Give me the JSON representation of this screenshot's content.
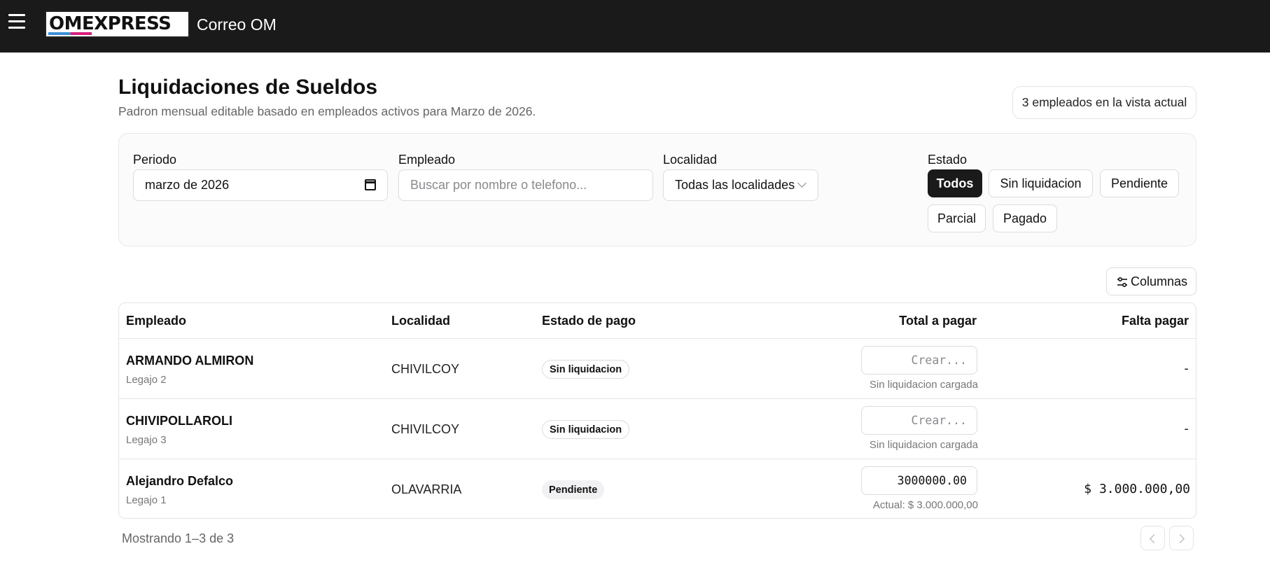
{
  "header": {
    "logo_text": "OMEXPRESS",
    "app_name": "Correo OM"
  },
  "page": {
    "title": "Liquidaciones de Sueldos",
    "subtitle": "Padron mensual editable basado en empleados activos para Marzo de 2026.",
    "count_badge": "3 empleados en la vista actual"
  },
  "filters": {
    "periodo_label": "Periodo",
    "periodo_value": "marzo de 2026",
    "empleado_label": "Empleado",
    "empleado_placeholder": "Buscar por nombre o telefono...",
    "localidad_label": "Localidad",
    "localidad_value": "Todas las localidades",
    "estado_label": "Estado",
    "estado_options": [
      "Todos",
      "Sin liquidacion",
      "Pendiente",
      "Parcial",
      "Pagado"
    ],
    "estado_selected": "Todos"
  },
  "toolbar": {
    "columns_label": "Columnas"
  },
  "table": {
    "headers": {
      "empleado": "Empleado",
      "localidad": "Localidad",
      "estado": "Estado de pago",
      "total": "Total a pagar",
      "falta": "Falta pagar"
    },
    "rows": [
      {
        "name": "ARMANDO ALMIRON",
        "legajo": "Legajo 2",
        "localidad": "CHIVILCOY",
        "estado": "Sin liquidacion",
        "total_placeholder": "Crear...",
        "total_value": "",
        "hint": "Sin liquidacion cargada",
        "falta": "-"
      },
      {
        "name": "CHIVIPOLLAROLI",
        "legajo": "Legajo 3",
        "localidad": "CHIVILCOY",
        "estado": "Sin liquidacion",
        "total_placeholder": "Crear...",
        "total_value": "",
        "hint": "Sin liquidacion cargada",
        "falta": "-"
      },
      {
        "name": "Alejandro Defalco",
        "legajo": "Legajo 1",
        "localidad": "OLAVARRIA",
        "estado": "Pendiente",
        "total_placeholder": "",
        "total_value": "3000000.00",
        "hint": "Actual: $ 3.000.000,00",
        "falta": "$ 3.000.000,00"
      }
    ]
  },
  "footer": {
    "showing": "Mostrando 1–3 de 3"
  }
}
